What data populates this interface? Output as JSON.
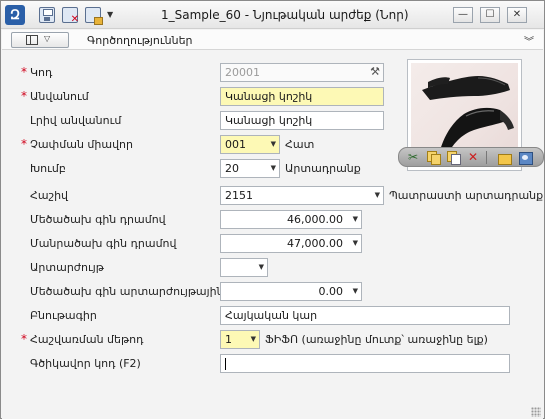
{
  "window": {
    "title": "1_Sample_60 - Նյութական արժեք (Նոր)",
    "minimize_glyph": "—",
    "maximize_glyph": "☐",
    "close_glyph": "✕"
  },
  "toolbar": {
    "buttons": [
      "save-icon",
      "save-close-icon",
      "save-open-icon"
    ],
    "more_glyph": "▼"
  },
  "menubar": {
    "label": "Գործողություններ",
    "collapse_glyph": "︾"
  },
  "form": {
    "code": {
      "label": "Կոդ",
      "value": "20001",
      "required": true
    },
    "name": {
      "label": "Անվանում",
      "value": "Կանացի կոշիկ",
      "required": true
    },
    "full_name": {
      "label": "Լրիվ անվանում",
      "value": "Կանացի կոշիկ"
    },
    "unit": {
      "label": "Չափման միավոր",
      "value": "001",
      "suffix": "Հատ",
      "required": true
    },
    "group": {
      "label": "Խումբ",
      "value": "20",
      "suffix": "Արտադրանք"
    },
    "account": {
      "label": "Հաշիվ",
      "value": "2151",
      "suffix": "Պատրաստի արտադրանք"
    },
    "wholesale_price": {
      "label": "Մեծածախ գին դրամով",
      "value": "46,000.00"
    },
    "retail_price": {
      "label": "Մանրածախ գին դրամով",
      "value": "47,000.00"
    },
    "currency": {
      "label": "Արտարժույթ",
      "value": ""
    },
    "wholesale_fx_price": {
      "label": "Մեծածախ գին արտարժույթային",
      "value": "0.00"
    },
    "description": {
      "label": "Բնութագիր",
      "value": "Հայկական կար"
    },
    "accounting_method": {
      "label": "Հաշվառման մեթոդ",
      "value": "1",
      "suffix": "ՖԻՖՈ (առաջինը մուտք՝ առաջինը ելք)",
      "required": true
    },
    "barcode": {
      "label": "Գծիկավոր կոդ (F2)",
      "value": ""
    }
  },
  "image_toolbar": [
    "cut-icon",
    "copy-icon",
    "paste-icon",
    "delete-icon",
    "open-folder-icon",
    "camera-icon"
  ],
  "colors": {
    "required_marker": "#d0021b",
    "required_field_bg": "#fdf9b5",
    "app_logo": "#2a5fa8"
  }
}
